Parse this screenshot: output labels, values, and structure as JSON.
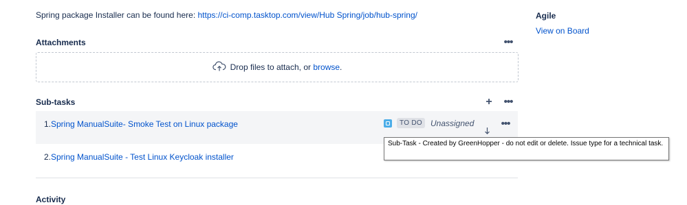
{
  "installer": {
    "text": "Spring package Installer can be found here: ",
    "link": "https://ci-comp.tasktop.com/view/Hub Spring/job/hub-spring/"
  },
  "attachments": {
    "title": "Attachments",
    "more": "•••",
    "drop_text": "Drop files to attach, or ",
    "browse": "browse",
    "period": "."
  },
  "subtasks": {
    "title": "Sub-tasks",
    "add": "+",
    "more": "•••",
    "items": [
      {
        "num": "1.",
        "title": "Spring ManualSuite- Smoke Test on Linux package",
        "status": "TO DO",
        "assignee": "Unassigned",
        "more": "•••"
      },
      {
        "num": "2.",
        "title": "Spring ManualSuite - Test Linux Keycloak installer"
      }
    ]
  },
  "tooltip": {
    "text": "Sub-Task - Created by GreenHopper - do not edit or delete. Issue type for a technical task."
  },
  "activity": {
    "title": "Activity"
  },
  "agile": {
    "title": "Agile",
    "link": "View on Board"
  },
  "colors": {
    "link": "#0052cc",
    "text": "#172b4d",
    "row_hover": "#f4f5f7",
    "subtask_icon": "#4bade8"
  }
}
